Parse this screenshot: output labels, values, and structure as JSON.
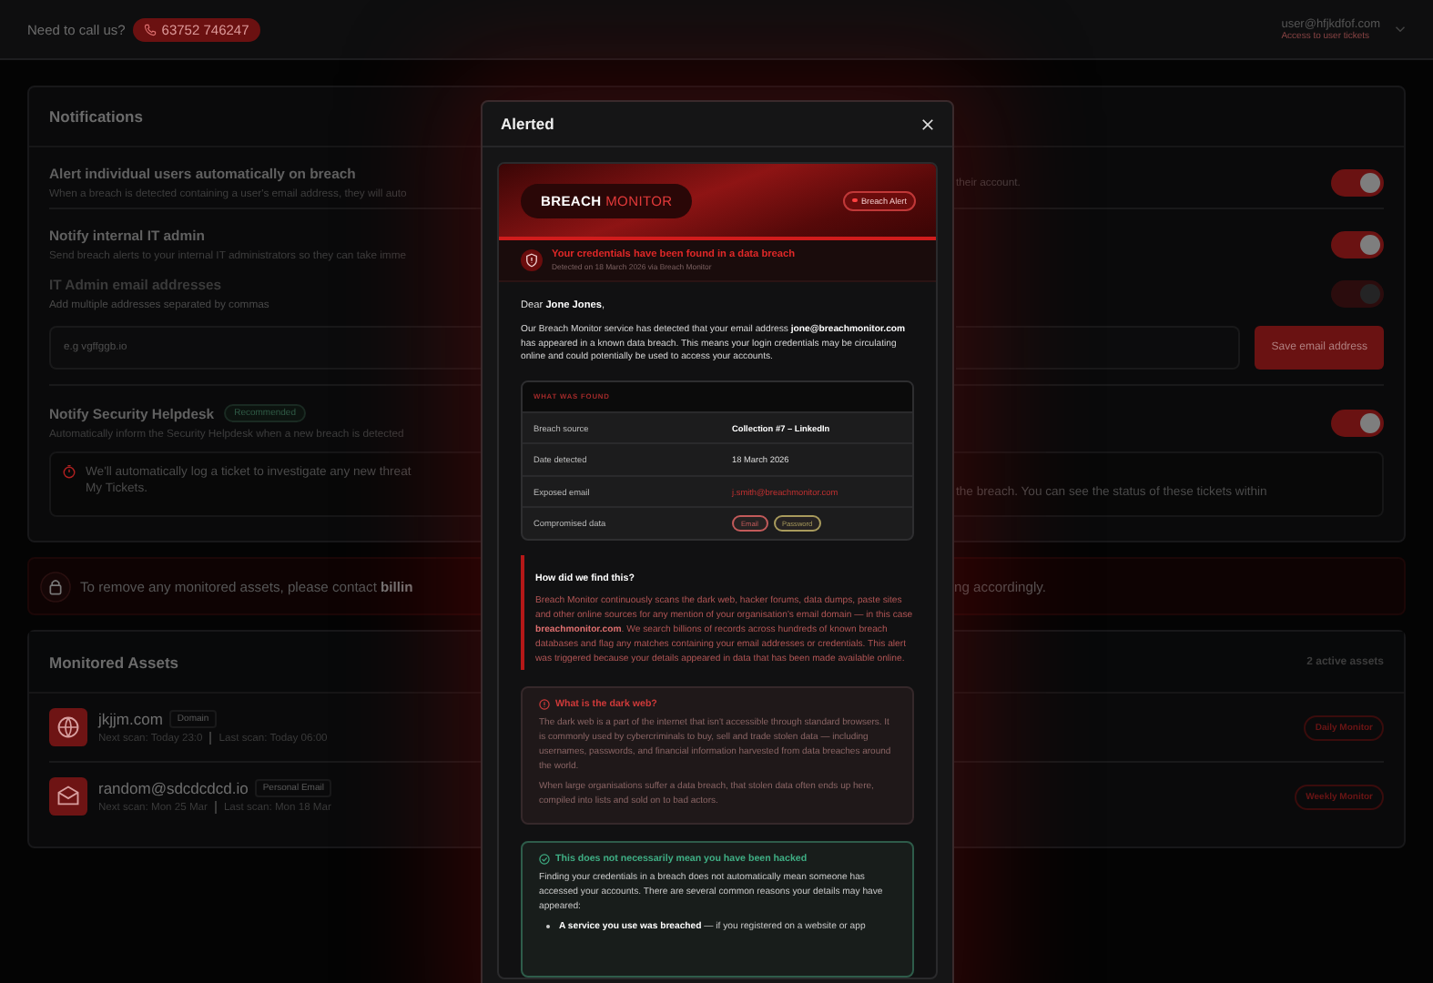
{
  "topbar": {
    "call_label": "Need to call us?",
    "phone": "63752 746247",
    "user_email": "user@hfjkdfof.com",
    "user_subtitle": "Access to user tickets"
  },
  "notifications": {
    "title": "Notifications",
    "settings": [
      {
        "title": "Alert individual users automatically on breach",
        "description": "When a breach is detected containing a user's email address, they will auto",
        "description_end": "their account.",
        "toggle": {
          "on": true,
          "disabled": false
        }
      },
      {
        "title": "Notify internal IT admin",
        "description": "Send breach alerts to your internal IT administrators so they can take imme",
        "toggle": {
          "on": true,
          "disabled": false
        },
        "sub_setting": {
          "title": "IT Admin email addresses",
          "description": "Add multiple addresses separated by commas",
          "toggle": {
            "on": true,
            "disabled": true
          },
          "field": {
            "placeholder": "e.g vgffggb.io",
            "button": "Save email address"
          }
        }
      },
      {
        "title": "Notify Security Helpdesk",
        "badge": "Recommended",
        "description": "Automatically inform the Security Helpdesk when a new breach is detected",
        "toggle": {
          "on": true,
          "disabled": false
        },
        "note": {
          "start": "We'll automatically log a ticket to investigate any new threat",
          "end": "the breach. You can see the status of these tickets within",
          "last_line": "My Tickets."
        }
      }
    ]
  },
  "banner": {
    "text": "To remove any monitored assets, please contact **billin**",
    "text_end": "ng accordingly."
  },
  "assets": {
    "title": "Monitored Assets",
    "count": "2 active assets",
    "items": [
      {
        "kind": "domain",
        "name": "jkjjm.com",
        "type": "Domain",
        "next_scan": "Next scan: Today 23:0",
        "last_scan": "Last scan: Today 06:00",
        "schedule": "Daily Monitor"
      },
      {
        "kind": "email",
        "name": "random@sdcdcdcd.io",
        "type": "Personal Email",
        "next_scan": "Next scan: Mon 25 Mar",
        "last_scan": "Last scan: Mon 18 Mar",
        "schedule": "Weekly Monitor"
      }
    ]
  },
  "modal": {
    "title": "Alerted",
    "email": {
      "logo_primary": "BREACH",
      "logo_accent": "MONITOR",
      "badge": "Breach Alert",
      "alert_title": "Your credentials have been found in a data breach",
      "alert_subtitle": "Detected on 18 March 2026 via Breach Monitor",
      "greeting": "Dear **Jone Jones**,",
      "intro": "Our Breach Monitor service has detected that your email address **jone@breachmonitor.com** has appeared in a known data breach. This means your login credentials may be circulating online and could potentially be used to access your accounts.",
      "found": {
        "heading": "WHAT WAS FOUND",
        "rows": [
          {
            "kind": "bold",
            "label": "Breach source",
            "value": "Collection #7 – LinkedIn"
          },
          {
            "kind": "text",
            "label": "Date detected",
            "value": "18 March 2026"
          },
          {
            "kind": "link",
            "label": "Exposed email",
            "value": "j.smith@breachmonitor.com"
          },
          {
            "kind": "tags",
            "label": "Compromised data",
            "tags": [
              {
                "label": "Email",
                "color": "#c25a5a"
              },
              {
                "label": "Password",
                "color": "#a89a5c"
              }
            ]
          }
        ]
      },
      "how": {
        "heading": "How did we find this?",
        "body": "Breach Monitor continuously scans the dark web, hacker forums, data dumps, paste sites and other online sources for any mention of your organisation's email domain — in this case **breachmonitor.com**. We search billions of records across hundreds of known breach databases and flag any matches containing your email addresses or credentials. This alert was triggered because your details appeared in data that has been made available online."
      },
      "dark_web": {
        "heading": "What is the dark web?",
        "paragraphs": [
          "The dark web is a part of the internet that isn't accessible through standard browsers. It is commonly used by cybercriminals to buy, sell and trade stolen data — including usernames, passwords, and financial information harvested from data breaches around the world.",
          "When large organisations suffer a data breach, that stolen data often ends up here, compiled into lists and sold on to bad actors."
        ]
      },
      "reassurance": {
        "heading": "This does not necessarily mean you have been hacked",
        "body": "Finding your credentials in a breach does not automatically mean someone has accessed your accounts. There are several common reasons your details may have appeared:",
        "bullets": [
          "**A service you use was breached** — if you registered on a website or app"
        ]
      }
    }
  }
}
